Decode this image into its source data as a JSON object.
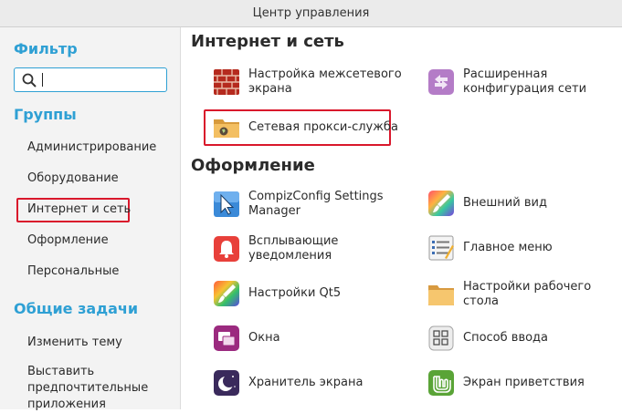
{
  "window": {
    "title": "Центр управления"
  },
  "sidebar": {
    "filter_heading": "Фильтр",
    "search_value": "",
    "groups_heading": "Группы",
    "groups": [
      {
        "label": "Администрирование"
      },
      {
        "label": "Оборудование"
      },
      {
        "label": "Интернет и сеть",
        "highlighted": true
      },
      {
        "label": "Оформление"
      },
      {
        "label": "Персональные"
      }
    ],
    "tasks_heading": "Общие задачи",
    "tasks": [
      {
        "label": "Изменить тему"
      },
      {
        "label": "Выставить предпочтительные приложения"
      }
    ]
  },
  "main": {
    "sections": [
      {
        "title": "Интернет и сеть",
        "items": [
          {
            "label": "Настройка межсетевого экрана",
            "icon": "firewall-brick-icon"
          },
          {
            "label": "Расширенная конфигурация сети",
            "icon": "network-config-icon"
          },
          {
            "label": "Сетевая прокси-служба",
            "icon": "proxy-folder-icon",
            "highlighted": true
          }
        ]
      },
      {
        "title": "Оформление",
        "items": [
          {
            "label": "CompizConfig Settings Manager",
            "icon": "compiz-cursor-icon"
          },
          {
            "label": "Внешний вид",
            "icon": "brush-icon"
          },
          {
            "label": "Всплывающие уведомления",
            "icon": "bell-icon"
          },
          {
            "label": "Главное меню",
            "icon": "menu-list-icon"
          },
          {
            "label": "Настройки Qt5",
            "icon": "qt5-brush-icon"
          },
          {
            "label": "Настройки рабочего стола",
            "icon": "desktop-folder-icon"
          },
          {
            "label": "Окна",
            "icon": "windows-icon"
          },
          {
            "label": "Способ ввода",
            "icon": "input-method-icon"
          },
          {
            "label": "Хранитель экрана",
            "icon": "screensaver-moon-icon"
          },
          {
            "label": "Экран приветствия",
            "icon": "mint-greeter-icon"
          }
        ]
      }
    ]
  },
  "colors": {
    "accent": "#2fa0d4",
    "highlight_box": "#d9172b"
  }
}
